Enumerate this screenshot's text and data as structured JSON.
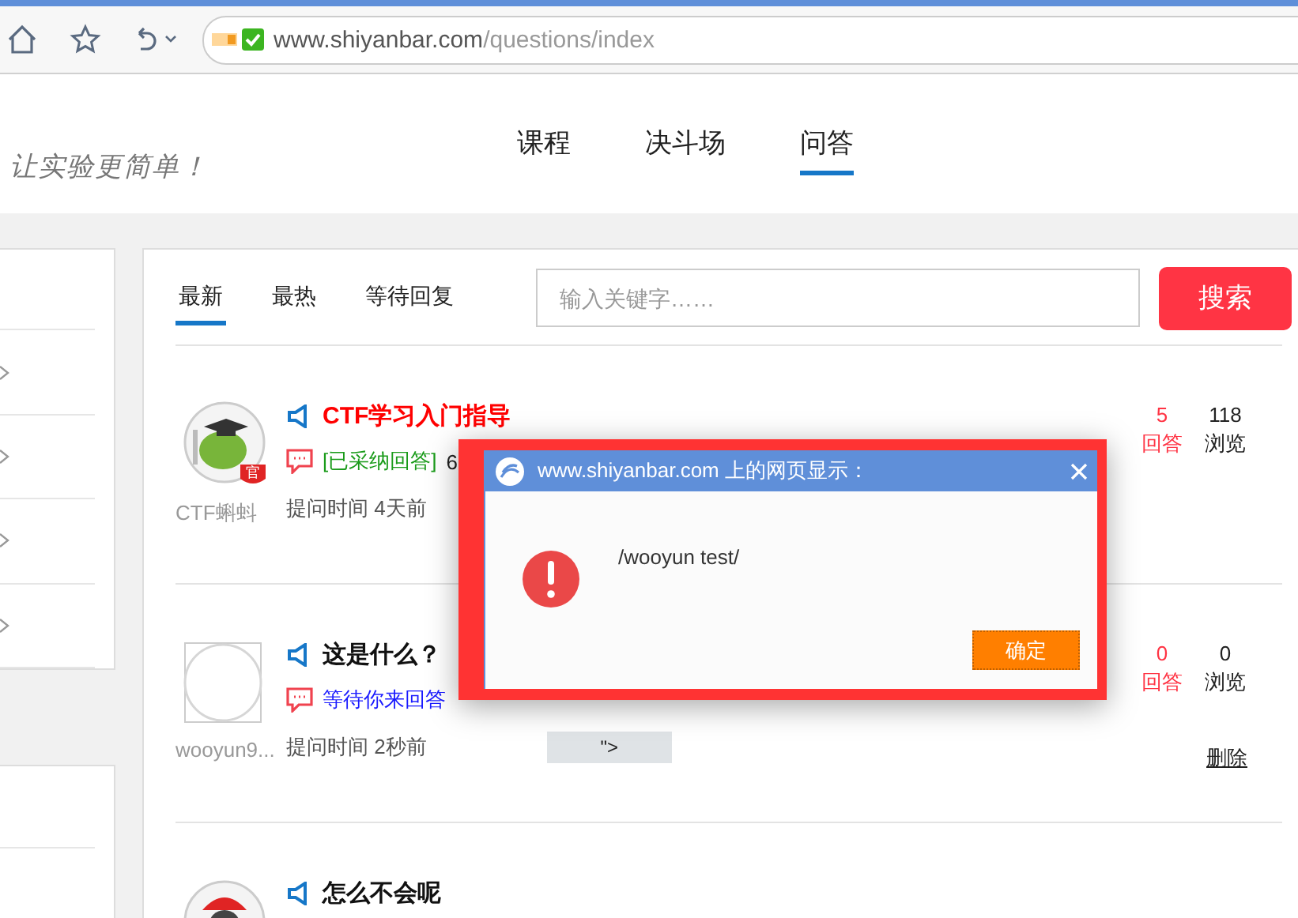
{
  "browser": {
    "address": {
      "host": "www.shiyanbar.com",
      "path": "/questions/index"
    }
  },
  "header": {
    "slogan": "让实验更简单！",
    "nav": [
      {
        "label": "课程",
        "selected": false
      },
      {
        "label": "决斗场",
        "selected": false
      },
      {
        "label": "问答",
        "selected": true
      }
    ]
  },
  "filters": {
    "tabs": [
      {
        "label": "最新",
        "selected": true
      },
      {
        "label": "最热",
        "selected": false
      },
      {
        "label": "等待回复",
        "selected": false
      }
    ],
    "search": {
      "placeholder": "输入关键字……",
      "button": "搜索"
    }
  },
  "questions": [
    {
      "avatar": {
        "kind": "mascot",
        "badge": "官"
      },
      "user": "CTF蝌蚪",
      "title": "CTF学习入门指导",
      "pinned": true,
      "status": {
        "kind": "accepted",
        "label": "[已采纳回答]",
        "detail": "6"
      },
      "asked": "提问时间 4天前",
      "answers": "5",
      "answers_label": "回答",
      "views": "118",
      "views_label": "浏览"
    },
    {
      "avatar": {
        "kind": "blank"
      },
      "user": "wooyun9...",
      "title": "这是什么？",
      "pinned": false,
      "status": {
        "kind": "waiting",
        "label": "等待你来回答"
      },
      "asked": "提问时间 2秒前",
      "snippet": "\">",
      "answers": "0",
      "answers_label": "回答",
      "views": "0",
      "views_label": "浏览",
      "delete": "删除"
    },
    {
      "avatar": {
        "kind": "person"
      },
      "title": "怎么不会呢",
      "pinned": false
    }
  ],
  "dialog": {
    "title": "www.shiyanbar.com 上的网页显示：",
    "message": "/wooyun test/",
    "button": "确定"
  }
}
